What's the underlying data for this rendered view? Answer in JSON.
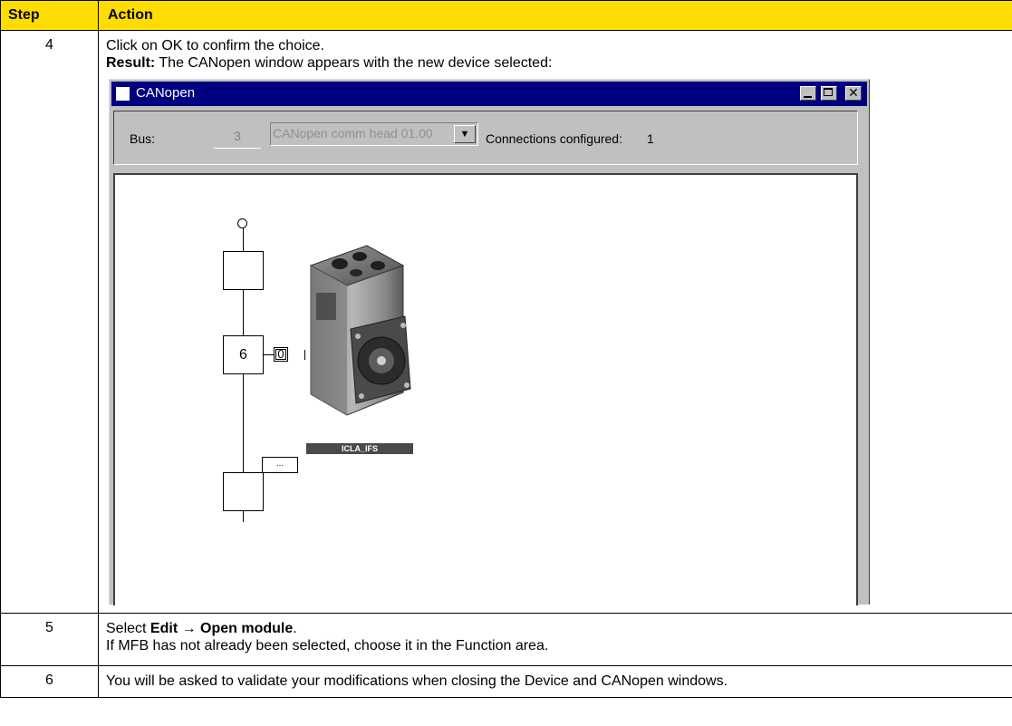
{
  "table": {
    "headers": {
      "step": "Step",
      "action": "Action"
    },
    "rows": [
      {
        "step": "4",
        "line1": "Click on OK to confirm the choice.",
        "result_label": "Result:",
        "result_text": " The CANopen window appears with the new device selected:"
      },
      {
        "step": "5",
        "select_prefix": "Select ",
        "menu_path": "Edit → Open module",
        "select_suffix": ".",
        "line2": "If MFB has not already been selected, choose it in the Function area."
      },
      {
        "step": "6",
        "line1": "You will be asked to validate your modifications when closing the Device and CANopen windows."
      }
    ]
  },
  "canopen_window": {
    "title": "CANopen",
    "bus_label": "Bus:",
    "bus_number": "3",
    "bus_device": "CANopen comm head 01.00",
    "connections_label": "Connections configured:",
    "connections_value": "1",
    "canvas": {
      "node_number": "6",
      "slot_number": "0",
      "more_label": "...",
      "device_label": "ICLA_IFS"
    }
  },
  "colors": {
    "header_bg": "#FFDD00",
    "titlebar_bg": "#000080",
    "window_bg": "#C0C0C0"
  }
}
